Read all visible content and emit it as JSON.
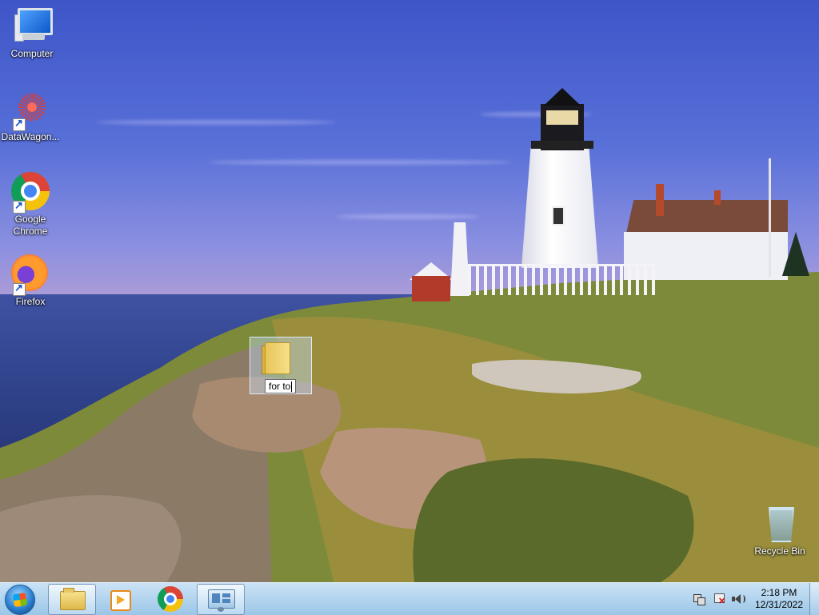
{
  "desktop": {
    "icons": [
      {
        "label": "Computer",
        "icon": "computer-icon"
      },
      {
        "label": "DataWagon...",
        "icon": "datawagon-icon",
        "shortcut": true
      },
      {
        "label": "Google Chrome",
        "icon": "chrome-icon",
        "shortcut": true
      },
      {
        "label": "Firefox",
        "icon": "firefox-icon",
        "shortcut": true
      },
      {
        "label": "Recycle Bin",
        "icon": "recycle-bin-icon"
      }
    ],
    "drag_item": {
      "label": "for to",
      "icon": "folder-icon"
    }
  },
  "taskbar": {
    "start": {
      "icon": "windows-start-orb-icon"
    },
    "pinned": [
      {
        "name": "Windows Explorer",
        "icon": "explorer-icon",
        "active": true
      },
      {
        "name": "Windows Media Player",
        "icon": "media-player-icon",
        "active": false
      },
      {
        "name": "Google Chrome",
        "icon": "chrome-icon",
        "active": false
      },
      {
        "name": "Control Panel",
        "icon": "control-panel-icon",
        "active": true
      }
    ],
    "tray": {
      "icons": [
        "network-icon",
        "action-center-flag-icon",
        "volume-icon"
      ],
      "time": "2:18 PM",
      "date": "12/31/2022"
    }
  },
  "colors": {
    "sky": "#4a60cc",
    "taskbar": "#b9d7ef",
    "label_text": "#ffffff"
  }
}
